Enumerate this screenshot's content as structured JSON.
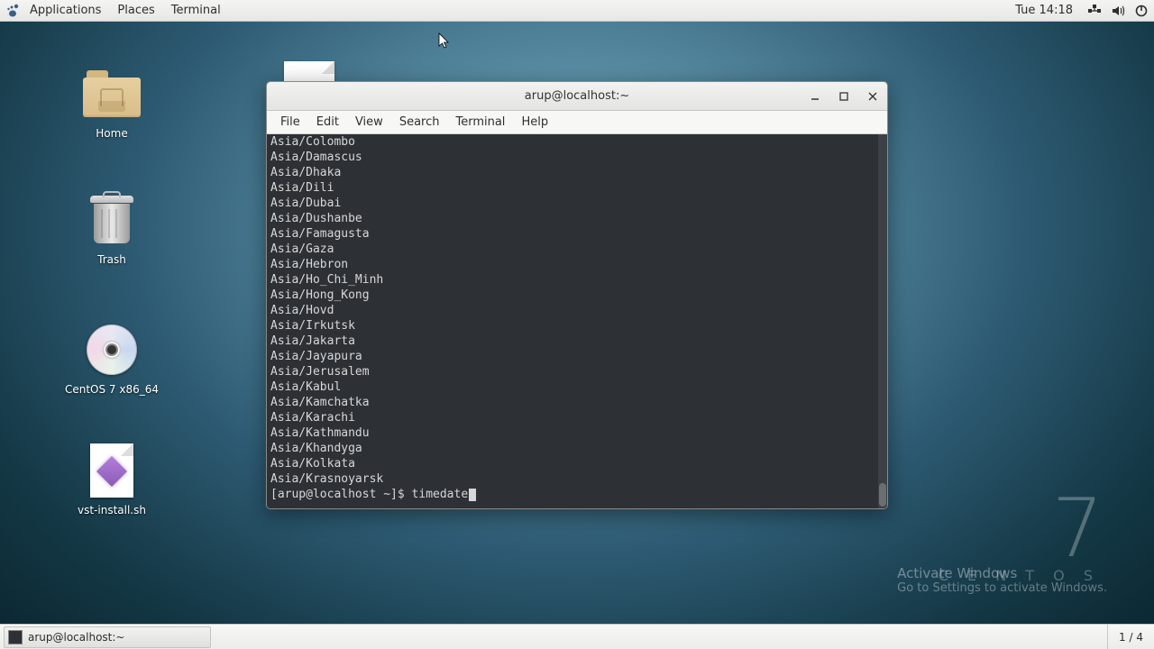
{
  "panel": {
    "applications": "Applications",
    "places": "Places",
    "terminal": "Terminal",
    "clock": "Tue 14:18"
  },
  "desktop": {
    "home": "Home",
    "trash": "Trash",
    "disc": "CentOS 7 x86_64",
    "script": "vst-install.sh"
  },
  "window": {
    "title": "arup@localhost:~",
    "menu": {
      "file": "File",
      "edit": "Edit",
      "view": "View",
      "search": "Search",
      "terminal": "Terminal",
      "help": "Help"
    }
  },
  "terminal": {
    "lines": [
      "Asia/Colombo",
      "Asia/Damascus",
      "Asia/Dhaka",
      "Asia/Dili",
      "Asia/Dubai",
      "Asia/Dushanbe",
      "Asia/Famagusta",
      "Asia/Gaza",
      "Asia/Hebron",
      "Asia/Ho_Chi_Minh",
      "Asia/Hong_Kong",
      "Asia/Hovd",
      "Asia/Irkutsk",
      "Asia/Jakarta",
      "Asia/Jayapura",
      "Asia/Jerusalem",
      "Asia/Kabul",
      "Asia/Kamchatka",
      "Asia/Karachi",
      "Asia/Kathmandu",
      "Asia/Khandyga",
      "Asia/Kolkata",
      "Asia/Krasnoyarsk"
    ],
    "prompt": "[arup@localhost ~]$ ",
    "typed": "timedate"
  },
  "watermark": {
    "seven": "7",
    "centos": "C E N T O S",
    "win_title": "Activate Windows",
    "win_sub": "Go to Settings to activate Windows."
  },
  "taskbar": {
    "task": "arup@localhost:~",
    "workspace": "1 / 4"
  }
}
